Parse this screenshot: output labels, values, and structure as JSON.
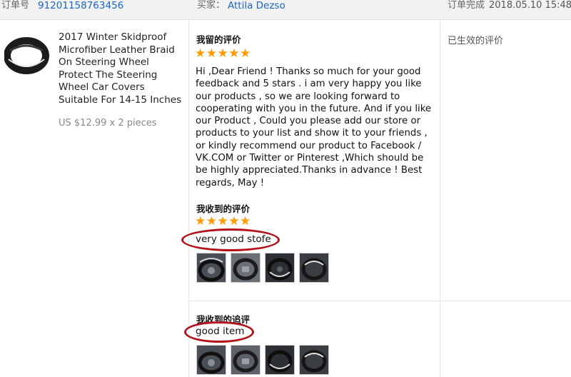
{
  "order": {
    "order_no_label": "订单号",
    "order_no": "91201158763456",
    "buyer_label": "买家：",
    "buyer_name": "Attila Dezso",
    "completed_label": "订单完成",
    "completed_date": "2018.05.10 15:48"
  },
  "product": {
    "title": "2017 Winter Skidproof Microfiber Leather Braid On Steering Wheel Protect The Steering Wheel Car Covers Suitable For 14-15 Inches",
    "price": "US $12.99 x 2 pieces"
  },
  "my_review": {
    "title": "我留的评价",
    "stars": "★★★★★",
    "rating": 5,
    "text": "Hi ,Dear Friend ! Thanks so much for your good feedback and 5 stars . i am very happy you like our products , so we are looking forward to cooperating with you in the future. And if you like our Product , Could you please add our store or products to your list and show it to your friends , or kindly recommend our product to Facebook / VK.COM or Twitter or Pinterest ,Which should be be highly appreciated.Thanks in advance ! Best regards, May !"
  },
  "received_review": {
    "title": "我收到的评价",
    "stars": "★★★★★",
    "rating": 5,
    "text": "very good stofe",
    "photo_count": 4
  },
  "followup_review": {
    "title": "我收到的追评",
    "text": "good item",
    "photo_count": 4
  },
  "status": {
    "text": "已生效的评价"
  },
  "colors": {
    "link": "#1a66c2",
    "star": "#ff9a00",
    "highlight_ring": "#b3121a"
  }
}
